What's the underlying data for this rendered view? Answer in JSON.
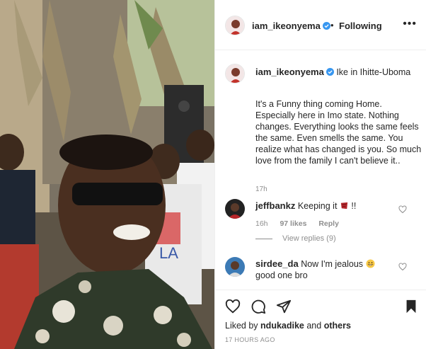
{
  "post": {
    "author": "iam_ikeonyema",
    "follow_separator": "•",
    "follow_state": "Following",
    "more_icon": "ellipsis-icon",
    "location": "Ike in Ihitte-Uboma",
    "caption": "It's a Funny thing coming Home. Especially here in Imo state. Nothing changes. Everything looks the same feels the same. Even smells the same. You realize what has changed is you. So much love from the family I can't believe it..",
    "caption_age": "17h",
    "liked_by_prefix": "Liked by",
    "liked_by_user": "ndukadike",
    "liked_by_conj": "and",
    "liked_by_others": "others",
    "posted": "17 HOURS AGO"
  },
  "comments": [
    {
      "user": "jeffbankz",
      "text": "Keeping it",
      "suffix": "!!",
      "age": "16h",
      "likes": "97 likes",
      "reply_label": "Reply",
      "view_replies": "View replies (9)"
    },
    {
      "user": "sirdee_da",
      "text": "Now I'm jealous",
      "text2": "good one bro"
    }
  ],
  "colors": {
    "text": "#262626",
    "secondary": "#8e8e8e",
    "verified": "#3897f0",
    "border": "#efefef"
  },
  "icons": [
    "heart-icon",
    "comment-icon",
    "share-icon",
    "bookmark-icon",
    "verified-badge-icon"
  ]
}
